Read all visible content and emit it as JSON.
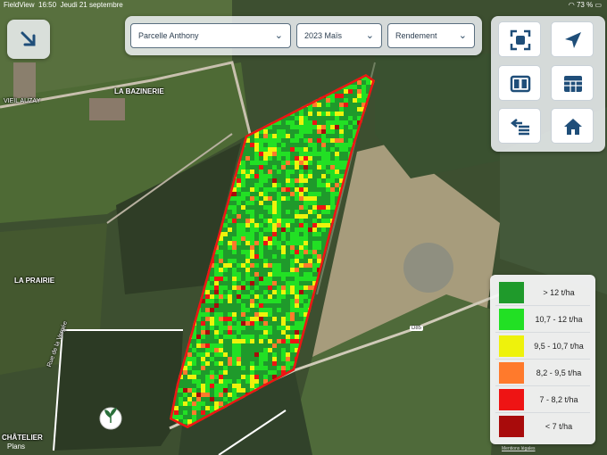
{
  "status_bar": {
    "app": "FieldView",
    "time": "16:50",
    "date": "Jeudi 21 septembre",
    "battery": "73 %"
  },
  "filters": {
    "field": "Parcelle Anthony",
    "season_crop": "2023 Maïs",
    "layer": "Rendement"
  },
  "buttons": {
    "collapse": "arrow-down-right-icon",
    "fit": "fit-to-field-icon",
    "locate": "location-arrow-icon",
    "split": "split-view-icon",
    "table": "table-icon",
    "swap": "swap-layers-icon",
    "home": "home-icon"
  },
  "map_labels": {
    "la_bazinerie": "LA BAZINERIE",
    "vieil_auzay": "VIEIL AUZAY",
    "la_prairie": "LA PRAIRIE",
    "rue": "Rue de la Vergée",
    "road": "D85",
    "chatelier": "CHÂTELIER",
    "plans": "Plans",
    "legal": "Mentions légales"
  },
  "legend": {
    "items": [
      {
        "label": "> 12 t/ha",
        "color": "#1f9a2b"
      },
      {
        "label": "10,7 - 12 t/ha",
        "color": "#22e024"
      },
      {
        "label": "9,5 - 10,7 t/ha",
        "color": "#eef20c"
      },
      {
        "label": "8,2 - 9,5 t/ha",
        "color": "#ff7a2c"
      },
      {
        "label": "7 - 8,2 t/ha",
        "color": "#ee1414"
      },
      {
        "label": "< 7 t/ha",
        "color": "#a80b0b"
      }
    ]
  }
}
